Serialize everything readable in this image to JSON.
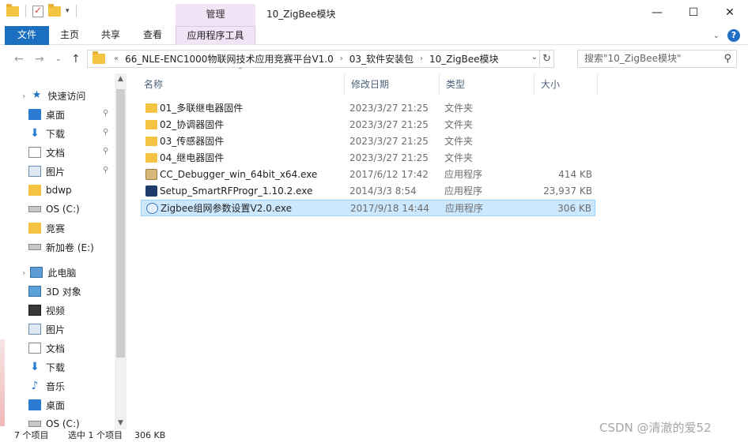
{
  "window": {
    "title": "10_ZigBee模块",
    "context_tab": "管理",
    "minimize": "—",
    "maximize": "☐",
    "close": "✕"
  },
  "ribbon": {
    "tabs": [
      "文件",
      "主页",
      "共享",
      "查看",
      "应用程序工具"
    ]
  },
  "address": {
    "crumbs": [
      "66_NLE-ENC1000物联网技术应用竞赛平台V1.0",
      "03_软件安装包",
      "10_ZigBee模块"
    ],
    "overflow": "«",
    "search_placeholder": "搜索\"10_ZigBee模块\""
  },
  "nav": {
    "items": [
      {
        "label": "快速访问",
        "icon": "star-icon",
        "pinned": false
      },
      {
        "label": "桌面",
        "icon": "desktop-icon",
        "pinned": true
      },
      {
        "label": "下载",
        "icon": "download-icon",
        "pinned": true
      },
      {
        "label": "文档",
        "icon": "document-icon",
        "pinned": true
      },
      {
        "label": "图片",
        "icon": "picture-icon",
        "pinned": true
      },
      {
        "label": "bdwp",
        "icon": "folder-icon",
        "pinned": false
      },
      {
        "label": "OS (C:)",
        "icon": "drive-icon",
        "pinned": false
      },
      {
        "label": "竞赛",
        "icon": "folder-icon",
        "pinned": false
      },
      {
        "label": "新加卷 (E:)",
        "icon": "drive-icon",
        "pinned": false
      },
      {
        "label": "此电脑",
        "icon": "computer-icon",
        "pinned": false
      },
      {
        "label": "3D 对象",
        "icon": "cube-icon",
        "pinned": false
      },
      {
        "label": "视频",
        "icon": "video-icon",
        "pinned": false
      },
      {
        "label": "图片",
        "icon": "picture-icon",
        "pinned": false
      },
      {
        "label": "文档",
        "icon": "document-icon",
        "pinned": false
      },
      {
        "label": "下载",
        "icon": "download-icon",
        "pinned": false
      },
      {
        "label": "音乐",
        "icon": "music-icon",
        "pinned": false
      },
      {
        "label": "桌面",
        "icon": "desktop-icon",
        "pinned": false
      },
      {
        "label": "OS (C:)",
        "icon": "drive-icon",
        "pinned": false
      }
    ]
  },
  "columns": {
    "name": "名称",
    "modified": "修改日期",
    "type": "类型",
    "size": "大小"
  },
  "files": [
    {
      "name": "01_多联继电器固件",
      "modified": "2023/3/27 21:25",
      "type": "文件夹",
      "size": "",
      "icon": "folder-icon"
    },
    {
      "name": "02_协调器固件",
      "modified": "2023/3/27 21:25",
      "type": "文件夹",
      "size": "",
      "icon": "folder-icon"
    },
    {
      "name": "03_传感器固件",
      "modified": "2023/3/27 21:25",
      "type": "文件夹",
      "size": "",
      "icon": "folder-icon"
    },
    {
      "name": "04_继电器固件",
      "modified": "2023/3/27 21:25",
      "type": "文件夹",
      "size": "",
      "icon": "folder-icon"
    },
    {
      "name": "CC_Debugger_win_64bit_x64.exe",
      "modified": "2017/6/12 17:42",
      "type": "应用程序",
      "size": "414 KB",
      "icon": "installer-icon"
    },
    {
      "name": "Setup_SmartRFProgr_1.10.2.exe",
      "modified": "2014/3/3 8:54",
      "type": "应用程序",
      "size": "23,937 KB",
      "icon": "setup-icon"
    },
    {
      "name": "Zigbee组网参数设置V2.0.exe",
      "modified": "2017/9/18 14:44",
      "type": "应用程序",
      "size": "306 KB",
      "icon": "zigbee-app-icon",
      "selected": true
    }
  ],
  "status": {
    "count": "7 个项目",
    "selection": "选中 1 个项目",
    "size": "306 KB"
  },
  "watermark": "CSDN @清澈的爱52",
  "colors": {
    "accent": "#1a6fc0",
    "context_tab": "#f3e3f7",
    "selection": "#cce8ff"
  }
}
